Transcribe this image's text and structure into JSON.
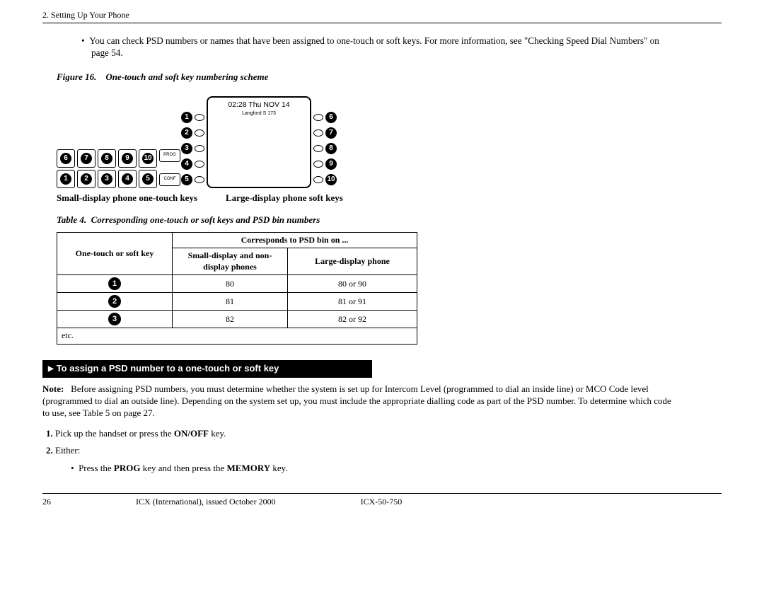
{
  "header": {
    "section": "2. Setting Up Your Phone"
  },
  "intro_bullet": "You can check PSD numbers or names that have been assigned to one-touch or soft keys.  For more information, see \"Checking Speed Dial Numbers\" on page 54.",
  "figure": {
    "label": "Figure 16.",
    "title": "One-touch and soft key numbering scheme",
    "small_btn1": "PROG",
    "small_btn2": "CONF",
    "large_time": "02:28  Thu   NOV 14",
    "large_sub": "Langford  S     173",
    "small_label": "Small-display phone one-touch keys",
    "large_label": "Large-display phone soft keys",
    "top_row_nums": [
      "6",
      "7",
      "8",
      "9",
      "10"
    ],
    "bottom_row_nums": [
      "1",
      "2",
      "3",
      "4",
      "5"
    ],
    "left_col_nums": [
      "1",
      "2",
      "3",
      "4",
      "5"
    ],
    "right_col_nums": [
      "6",
      "7",
      "8",
      "9",
      "10"
    ]
  },
  "table": {
    "label": "Table 4.",
    "title": "Corresponding one-touch or soft keys and PSD bin numbers",
    "headers": {
      "col1": "One-touch or soft key",
      "col2": "Corresponds to PSD bin on ...",
      "sub1": "Small-display and non-display phones",
      "sub2": "Large-display phone"
    },
    "rows": [
      {
        "key": "1",
        "small": "80",
        "large": "80 or 90"
      },
      {
        "key": "2",
        "small": "81",
        "large": "81 or 91"
      },
      {
        "key": "3",
        "small": "82",
        "large": "82 or 92"
      }
    ],
    "etc": "etc."
  },
  "black_bar": "To assign a PSD number to a one-touch or soft key",
  "note": {
    "label": "Note:",
    "text": "Before assigning PSD numbers, you must determine whether the system is set up for Intercom Level (programmed to dial an inside line) or MCO Code level (programmed to dial an outside line). Depending on the system set up, you must include the appropriate dialling code as part of the PSD number. To determine which code to use, see Table 5 on page 27."
  },
  "steps": {
    "s1_pre": "Pick up the handset or press the ",
    "s1_bold": "ON/OFF",
    "s1_post": " key.",
    "s2": "Either:",
    "sub_pre": "Press the ",
    "sub_b1": "PROG",
    "sub_mid": " key and then press the ",
    "sub_b2": "MEMORY",
    "sub_post": " key."
  },
  "footer": {
    "page": "26",
    "center": "ICX (International), issued October 2000",
    "right": "ICX-50-750"
  }
}
